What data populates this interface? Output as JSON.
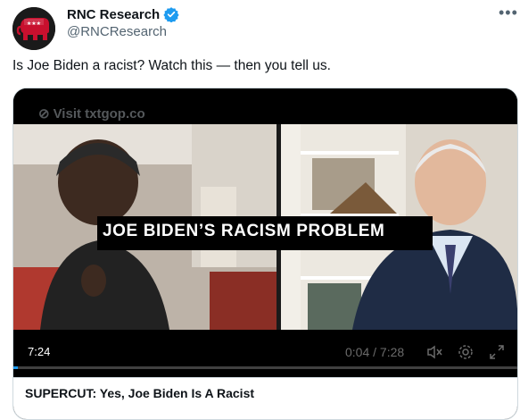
{
  "author": {
    "name": "RNC Research",
    "handle": "@RNCResearch"
  },
  "menu": {
    "more_label": "•••"
  },
  "tweet": {
    "text": "Is Joe Biden a racist? Watch this — then you tell us."
  },
  "video": {
    "watermark": "Visit txtgop.co",
    "caption": "JOE BIDEN’S RACISM PROBLEM",
    "duration_badge": "7:24",
    "time_display": "0:04 / 7:28",
    "progress": 0.009,
    "icons": [
      "mute-icon",
      "settings-icon",
      "fullscreen-icon"
    ]
  },
  "card": {
    "title": "SUPERCUT: Yes, Joe Biden Is A Racist"
  },
  "colors": {
    "accent": "#1d9bf0",
    "brand_red": "#c8102e",
    "text_secondary": "#536471"
  }
}
